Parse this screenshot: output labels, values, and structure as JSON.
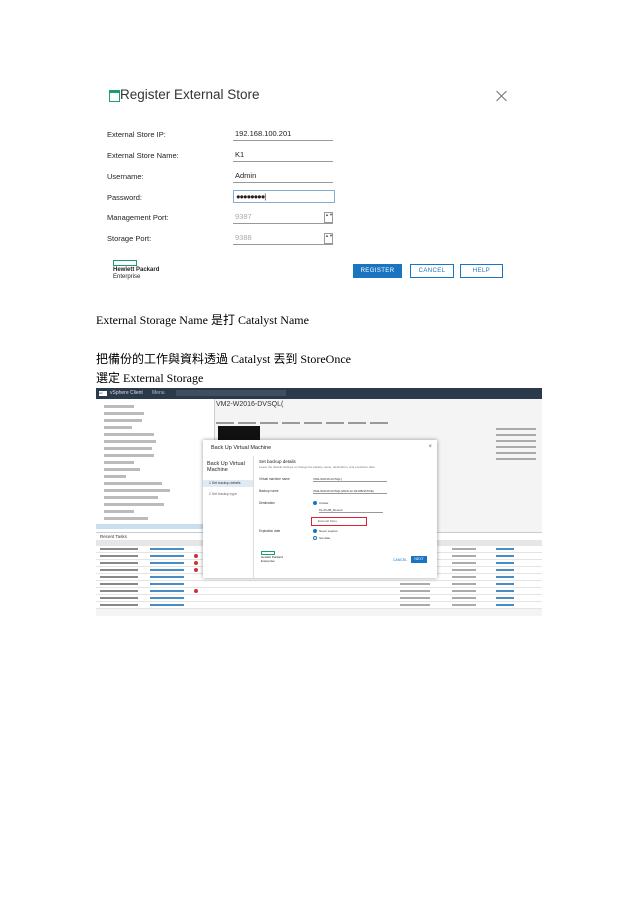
{
  "register_dialog": {
    "title": "Register External Store",
    "fields": [
      {
        "label": "External Store IP:",
        "value": "192.168.100.201"
      },
      {
        "label": "External Store Name:",
        "value": "K1"
      },
      {
        "label": "Username:",
        "value": "Admin"
      },
      {
        "label": "Password:",
        "value": "●●●●●●●●|"
      },
      {
        "label": "Management Port:",
        "value": "9387"
      },
      {
        "label": "Storage Port:",
        "value": "9388"
      }
    ],
    "logo_line1": "Hewlett Packard",
    "logo_line2": "Enterprise",
    "buttons": {
      "register": "REGISTER",
      "cancel": "CANCEL",
      "help": "HELP"
    },
    "spinner": "▲▼"
  },
  "text": {
    "line1": "External Storage Name  是打 Catalyst Name",
    "line2": "把備份的工作與資料透過 Catalyst  丟到 StoreOnce",
    "line3": "選定  External Storage"
  },
  "screenshot": {
    "app_title": "vSphere Client",
    "menu": "Menu",
    "logo": "vm",
    "vm_name": "VM2-W2016-DVSQL(",
    "tasks_tab": "Recent Tasks",
    "modal": {
      "title": "Back Up Virtual Machine",
      "close": "×",
      "side_title": "Back Up Virtual Machine",
      "step1": "1 Set backup details",
      "step2": "2 Set backup type",
      "heading": "Set backup details",
      "subheading": "Leave the default settings or change the backup name, destination, and expiration date.",
      "vm_label": "Virtual machine name",
      "vm_value": "VM2-W2016-DVSQL(",
      "backup_label": "Backup name",
      "backup_value": "VM2-W2016-DVSQL(2020-12-03-DBNATIVE)",
      "dest_label": "Destination",
      "dest_opt1": "Cluster",
      "dest_opt1_value": "K1-PLAB_Recent",
      "dest_opt2": "External Store",
      "exp_label": "Expiration date",
      "exp_opt1": "Never expires",
      "exp_opt2": "Set date",
      "hpe_line1": "Hewlett Packard",
      "hpe_line2": "Enterprise",
      "cancel": "CANCEL",
      "next": "NEXT"
    }
  }
}
